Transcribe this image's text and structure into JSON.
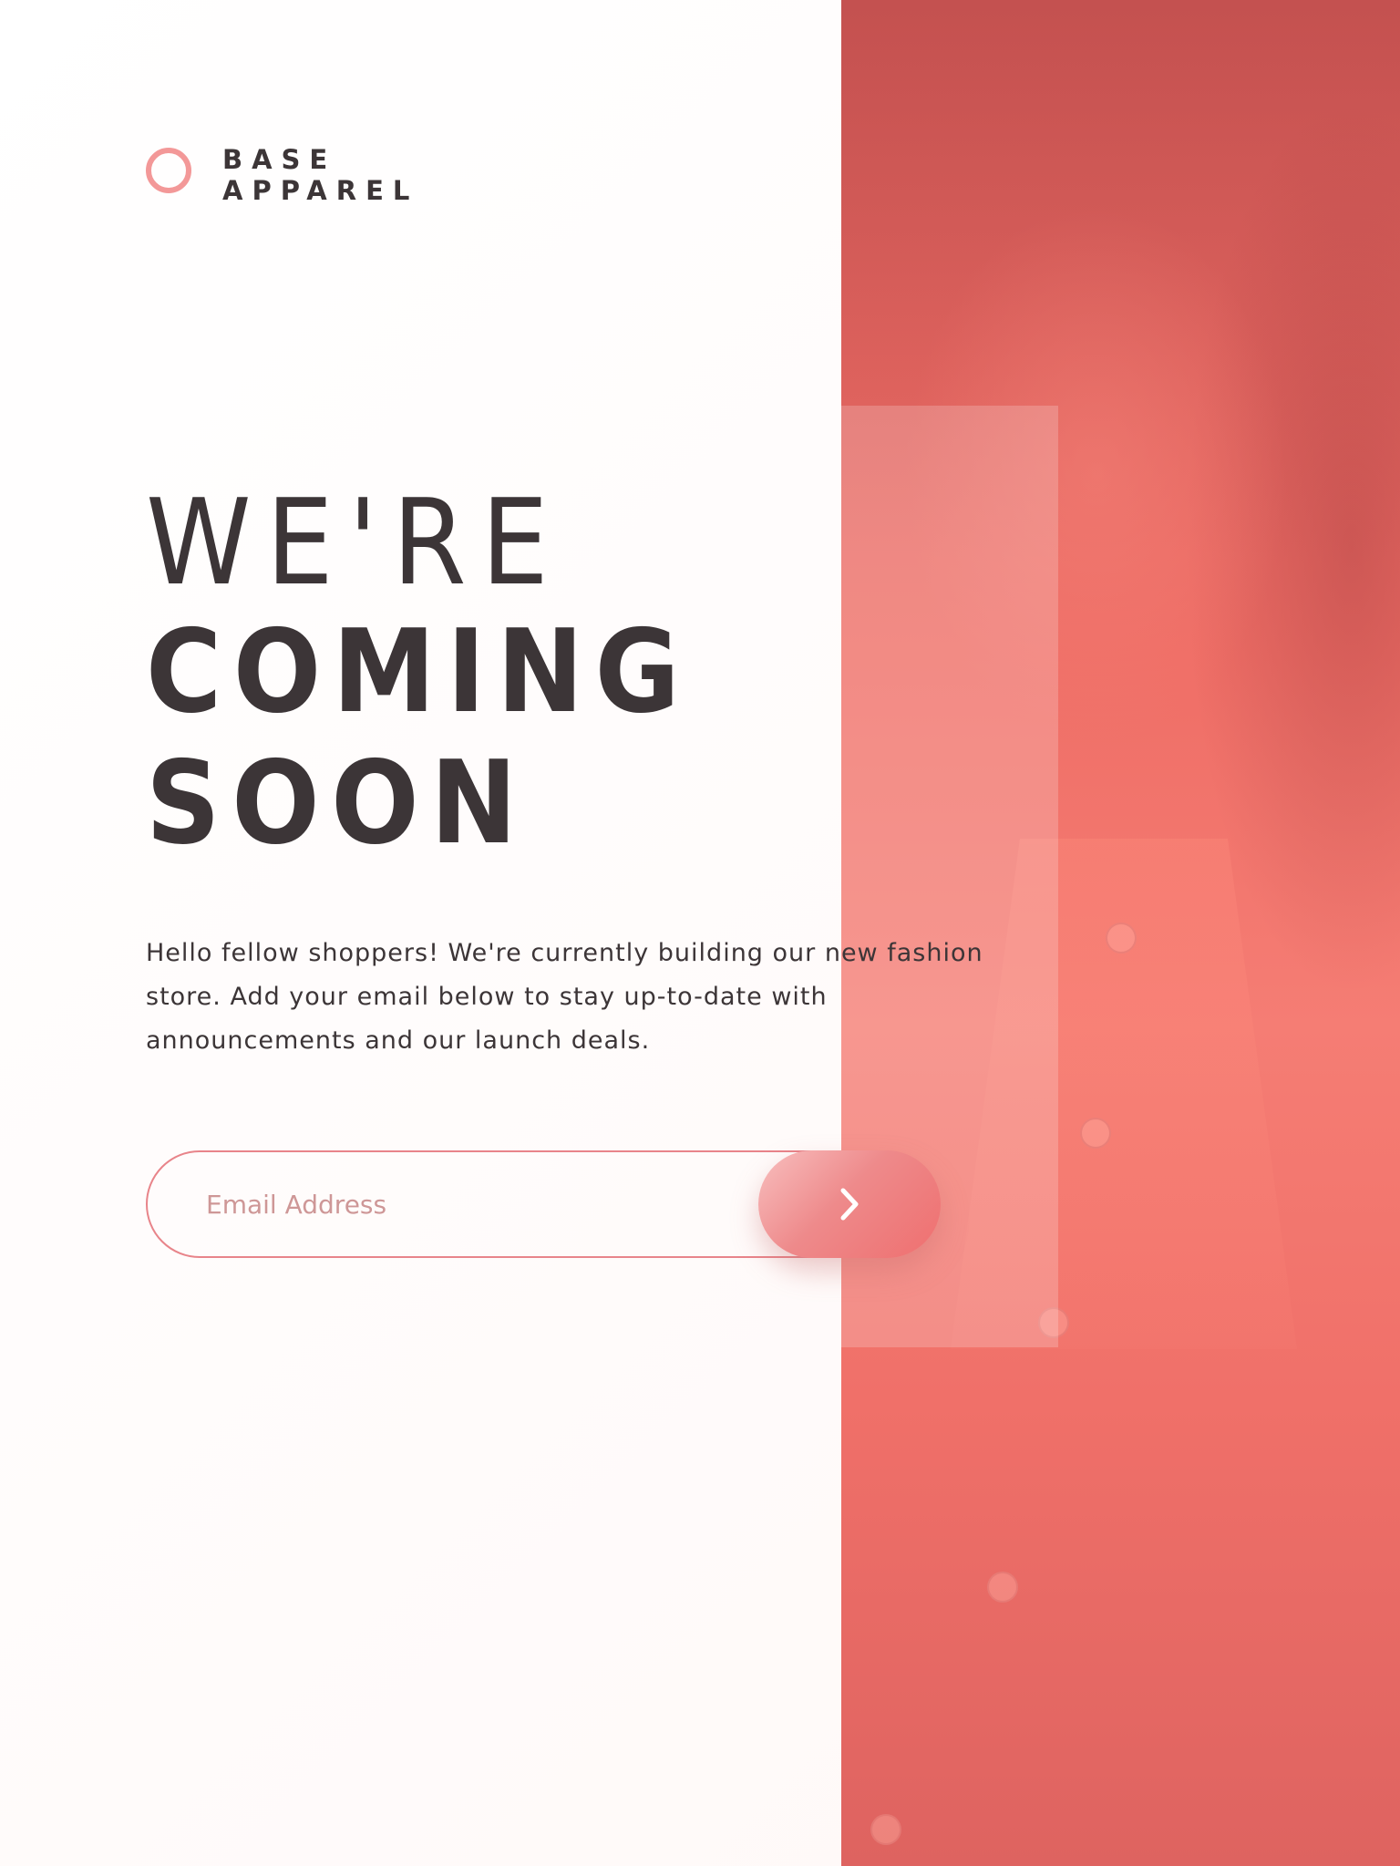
{
  "brand": {
    "line1": "BASE",
    "line2": "APPAREL",
    "ring_color": "#f39898"
  },
  "headline": {
    "light": "WE'RE",
    "bold_line1": "COMING",
    "bold_line2": "SOON"
  },
  "description": "Hello fellow shoppers! We're currently building our new fashion store. Add your email below to stay up-to-date with announcements and our launch deals.",
  "form": {
    "email_placeholder": "Email Address",
    "email_value": "",
    "submit_icon": "chevron-right-icon"
  },
  "hero": {
    "image": "hero-photo",
    "tint_color": "#f07069"
  },
  "colors": {
    "text": "#3c3537",
    "accent": "#ef6f6f",
    "placeholder": "#ce9797",
    "field_border": "#e8848a"
  }
}
